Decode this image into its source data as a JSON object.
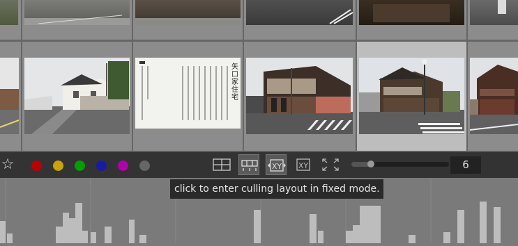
{
  "colors": {
    "red": "#c00000",
    "yellow": "#c9a300",
    "green": "#00a000",
    "blue": "#1a1aa8",
    "magenta": "#b000b0",
    "gray": "#666666"
  },
  "toolbar": {
    "star_icon": "star-icon",
    "color_labels": [
      "red",
      "yellow",
      "green",
      "blue",
      "magenta",
      "gray"
    ],
    "layout_buttons": [
      {
        "name": "file-manager-layout",
        "active": false
      },
      {
        "name": "zoomable-lighttable-layout",
        "active": true
      },
      {
        "name": "culling-fixed-layout",
        "active": true
      },
      {
        "name": "culling-dynamic-layout",
        "active": false
      },
      {
        "name": "preview-layout",
        "active": false
      }
    ],
    "zoom_fraction": 0.2,
    "zoom_count": "6"
  },
  "tooltip": {
    "text": "click to enter culling layout in fixed mode."
  },
  "document_thumb": {
    "heading": "矢口家住宅"
  }
}
